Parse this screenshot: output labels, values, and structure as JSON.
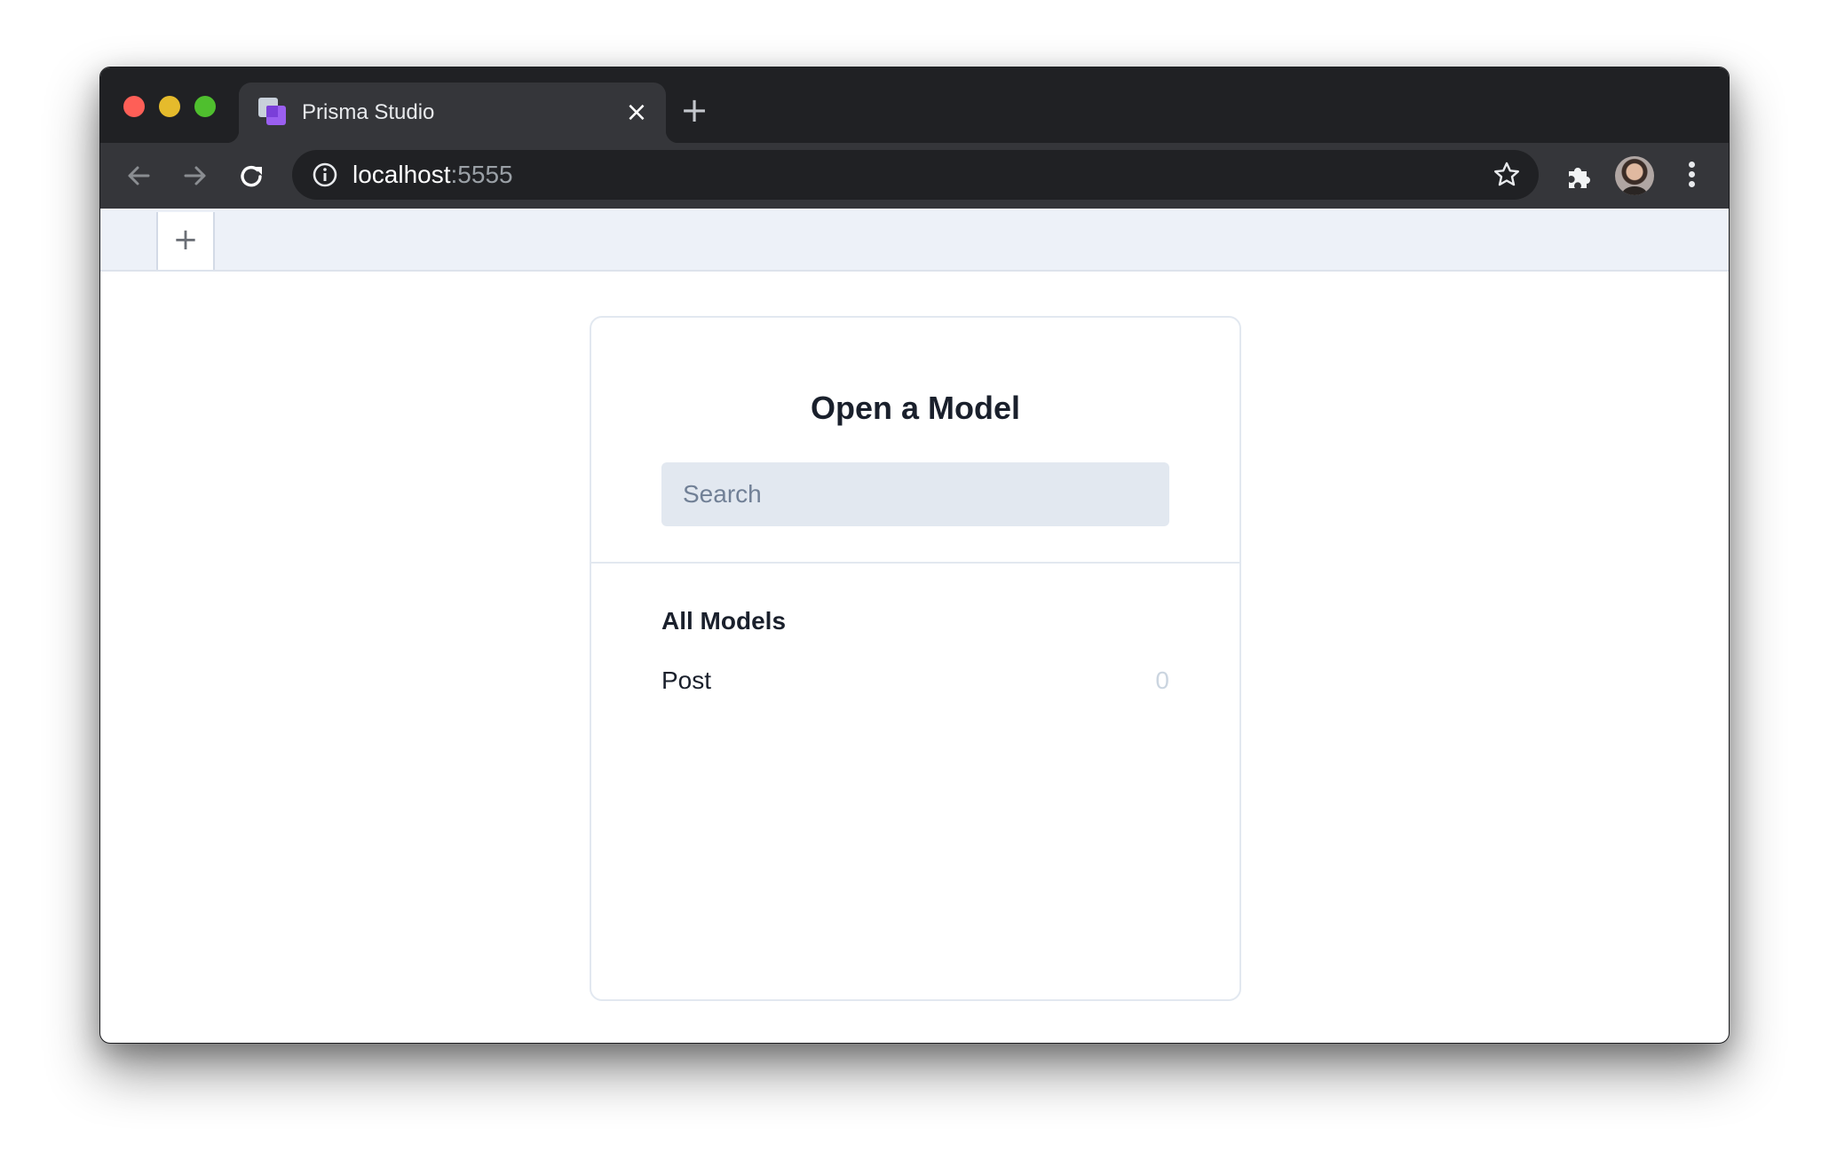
{
  "browser": {
    "tab": {
      "title": "Prisma Studio",
      "favicon": "prisma-studio-icon",
      "close_icon": "close-icon"
    },
    "new_tab_icon": "plus-icon",
    "nav": {
      "back_icon": "arrow-left-icon",
      "forward_icon": "arrow-right-icon",
      "reload_icon": "reload-icon"
    },
    "address_bar": {
      "host": "localhost",
      "port": ":5555",
      "site_info_icon": "info-icon",
      "bookmark_icon": "star-icon"
    },
    "toolbar_icons": [
      "puzzle-icon",
      "avatar",
      "kebab-menu-icon"
    ],
    "colors": {
      "titlebar": "#202124",
      "toolbar": "#35363a",
      "close": "#fe5f57",
      "minimize": "#e5bb2c",
      "maximize": "#4fbf2e"
    }
  },
  "studio": {
    "tabs_bar": {
      "add_tab_label": "+"
    },
    "open_model_dialog": {
      "title": "Open a Model",
      "search": {
        "placeholder": "Search",
        "value": ""
      },
      "section_title": "All Models",
      "models": [
        {
          "name": "Post",
          "count": "0"
        }
      ]
    },
    "colors": {
      "tabs_bar_bg": "#edf1f8",
      "search_bg": "#e2e8f0",
      "text": "#1a202c",
      "muted": "#cbd5e0"
    }
  }
}
